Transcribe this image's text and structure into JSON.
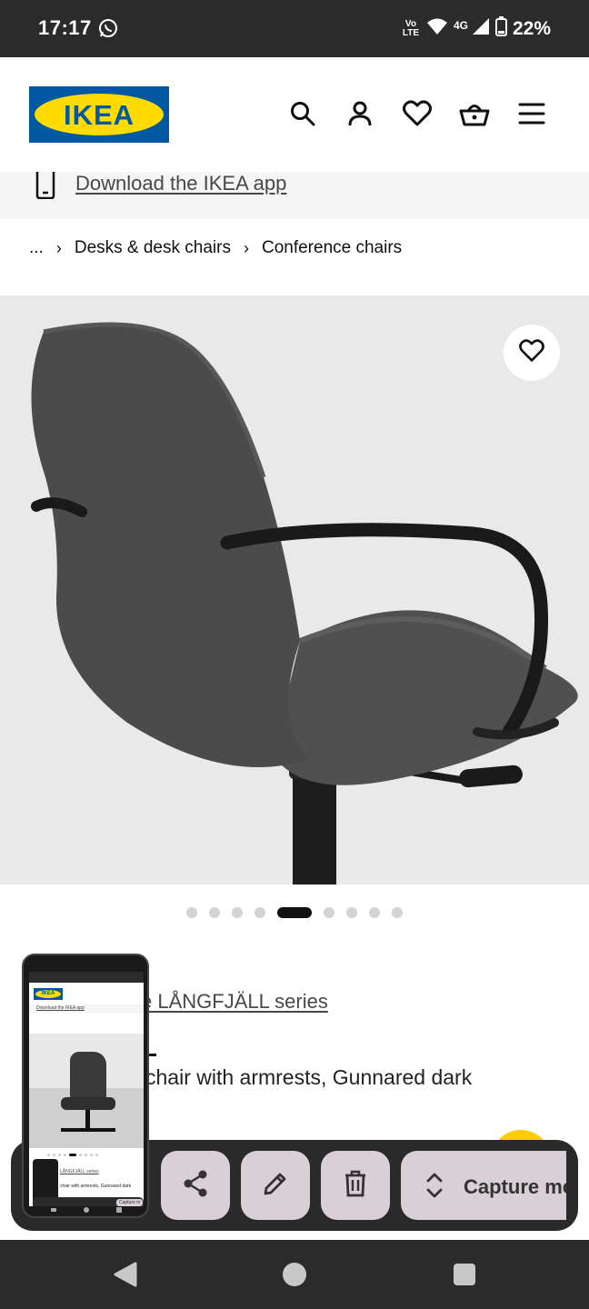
{
  "status_bar": {
    "time": "17:17",
    "network": "4G",
    "volte": "Vo LTE",
    "battery": "22%"
  },
  "header": {
    "logo_text": "IKEA",
    "icons": [
      "search-icon",
      "account-icon",
      "heart-icon",
      "basket-icon",
      "menu-icon"
    ]
  },
  "app_banner": {
    "link_text": "Download the IKEA app"
  },
  "breadcrumb": {
    "items": [
      "...",
      "Desks & desk chairs",
      "Conference chairs"
    ]
  },
  "product": {
    "series_link": "e LÅNGFJÄLL series",
    "description": "chair with armrests, Gunnared dark"
  },
  "carousel": {
    "total": 9,
    "active_index": 4
  },
  "screenshot_toolbar": {
    "capture_label": "Capture mo",
    "thumbnail": {
      "series_link": "LÅNGFJÄLL series",
      "description": "chair with armrests, Gunnared dark",
      "capture_label": "Capture m"
    }
  },
  "colors": {
    "ikea_blue": "#0058a3",
    "ikea_yellow": "#ffdb00",
    "toolbar_button": "#d9cfd6",
    "system_bar": "#2b2b2b"
  }
}
